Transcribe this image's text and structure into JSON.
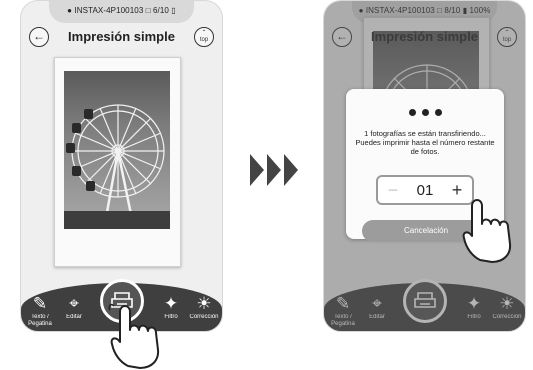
{
  "screens": [
    {
      "status": {
        "device": "INSTAX-4P100103",
        "photos": "6/10"
      },
      "header": {
        "back_glyph": "←",
        "title": "Impresión simple",
        "top_label": "top"
      },
      "toolbar": {
        "text_label": "Texto / Pegatina",
        "edit_label": "Editar",
        "filter_label": "Filtro",
        "correction_label": "Corrección"
      }
    },
    {
      "status": {
        "device": "INSTAX-4P100103",
        "photos": "8/10",
        "battery": "100%"
      },
      "header": {
        "back_glyph": "←",
        "title": "Impresión simple",
        "top_label": "top"
      },
      "dialog": {
        "message": "1 fotografías se están transfiriendo... Puedes imprimir hasta el número restante de fotos.",
        "count": "01",
        "minus_glyph": "−",
        "plus_glyph": "+",
        "cancel_label": "Cancelación"
      },
      "toolbar": {
        "text_label": "Texto / Pegatina",
        "edit_label": "Editar",
        "filter_label": "Filtro",
        "correction_label": "Corrección"
      }
    }
  ],
  "icons": [
    "bluetooth-icon",
    "film-icon",
    "battery-icon",
    "text-sticker-icon",
    "crop-icon",
    "print-icon",
    "magic-wand-icon",
    "brightness-icon",
    "hand-pointer-icon",
    "arrow-right-icon"
  ]
}
